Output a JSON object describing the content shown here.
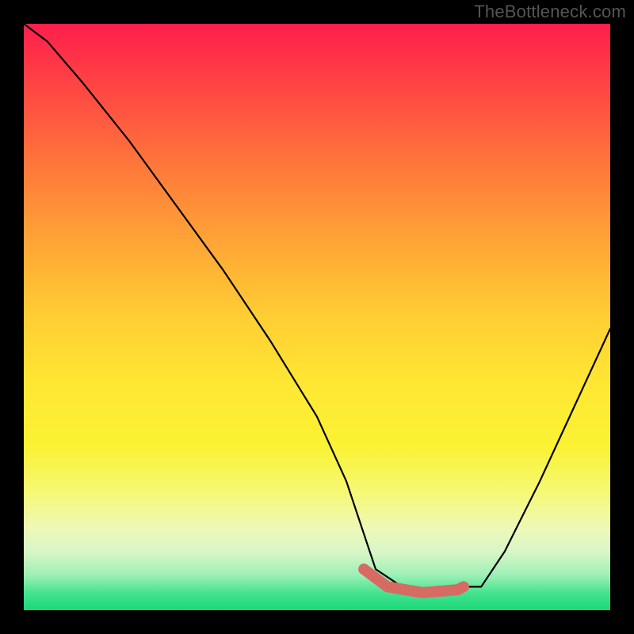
{
  "watermark": "TheBottleneck.com",
  "chart_data": {
    "type": "line",
    "title": "",
    "xlabel": "",
    "ylabel": "",
    "xlim": [
      0,
      100
    ],
    "ylim": [
      0,
      100
    ],
    "grid": false,
    "series": [
      {
        "name": "bottleneck-curve",
        "x": [
          0,
          4,
          10,
          18,
          26,
          34,
          42,
          50,
          55,
          58,
          60,
          66,
          72,
          75,
          78,
          82,
          88,
          94,
          100
        ],
        "values": [
          100,
          97,
          90,
          80,
          69,
          58,
          46,
          33,
          22,
          13,
          7,
          3,
          3,
          4,
          4,
          10,
          22,
          35,
          48
        ]
      }
    ],
    "highlight": {
      "name": "optimal-range",
      "x": [
        58,
        62,
        68,
        74,
        75
      ],
      "values": [
        7,
        4,
        3,
        3.5,
        4
      ]
    },
    "gradient_stops": [
      {
        "pct": 0,
        "color": "#ff1e4c"
      },
      {
        "pct": 12,
        "color": "#ff4a42"
      },
      {
        "pct": 25,
        "color": "#ff7a3a"
      },
      {
        "pct": 37,
        "color": "#ffa436"
      },
      {
        "pct": 50,
        "color": "#ffce33"
      },
      {
        "pct": 62,
        "color": "#ffe833"
      },
      {
        "pct": 72,
        "color": "#faf233"
      },
      {
        "pct": 80,
        "color": "#f6f876"
      },
      {
        "pct": 86,
        "color": "#eef8b8"
      },
      {
        "pct": 90,
        "color": "#d8f6c6"
      },
      {
        "pct": 94,
        "color": "#9ef0b6"
      },
      {
        "pct": 97,
        "color": "#46e38f"
      },
      {
        "pct": 100,
        "color": "#18d879"
      }
    ],
    "colors": {
      "curve": "#000000",
      "highlight": "#d86a64",
      "background_frame": "#000000"
    }
  }
}
